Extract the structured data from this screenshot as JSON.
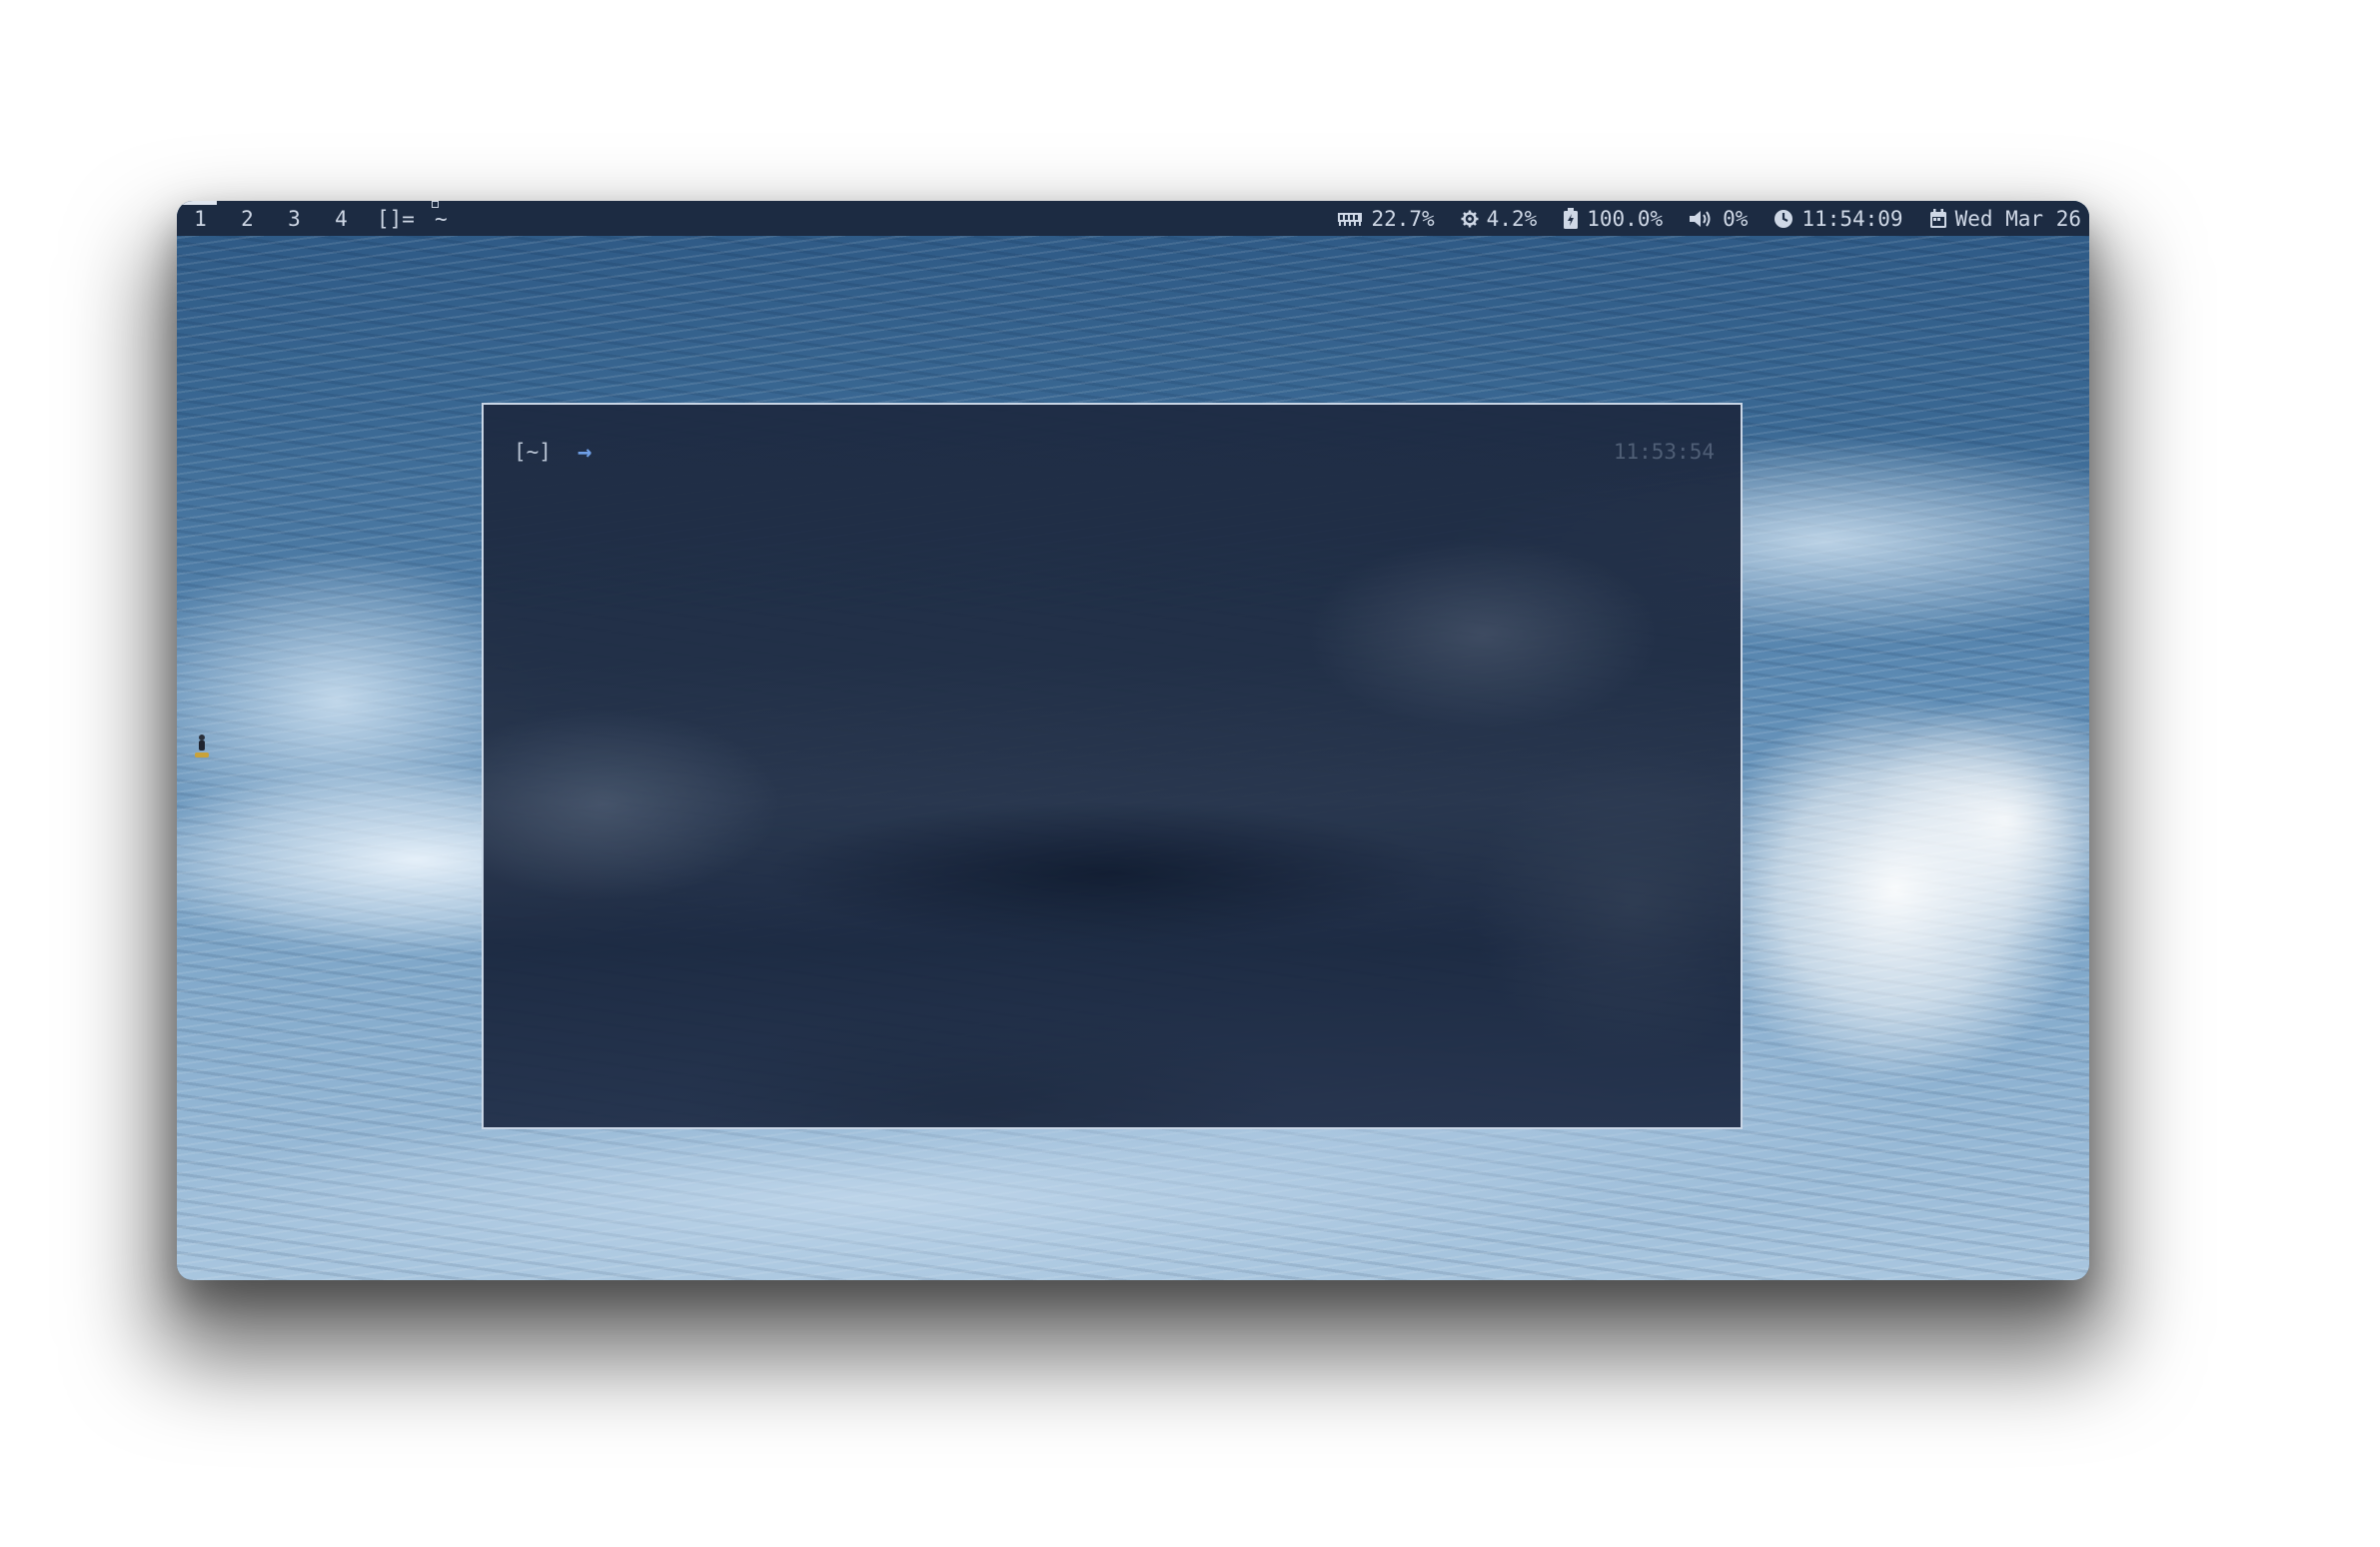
{
  "bar": {
    "workspaces": [
      "1",
      "2",
      "3",
      "4"
    ],
    "active_workspace": "1",
    "layout": "[]=",
    "window_title": "~",
    "memory": "22.7%",
    "cpu": "4.2%",
    "battery": "100.0%",
    "volume": "0%",
    "clock": "11:54:09",
    "date": "Wed Mar 26",
    "icons": {
      "memory": "memory-icon",
      "cpu": "cpu-icon",
      "battery": "battery-charging-icon",
      "volume": "speaker-icon",
      "clock": "clock-icon",
      "date": "calendar-icon"
    }
  },
  "terminal": {
    "prompt_dir": "[~]",
    "prompt_arrow": "→",
    "right_prompt_time": "11:53:54"
  },
  "colors": {
    "bar_bg": "#1c2b42",
    "bar_fg": "#cfd8e6",
    "terminal_bg": "#1e2b43",
    "terminal_border": "#c9d6e6",
    "prompt_arrow": "#6f9fe6",
    "right_prompt": "#4f5e75"
  }
}
